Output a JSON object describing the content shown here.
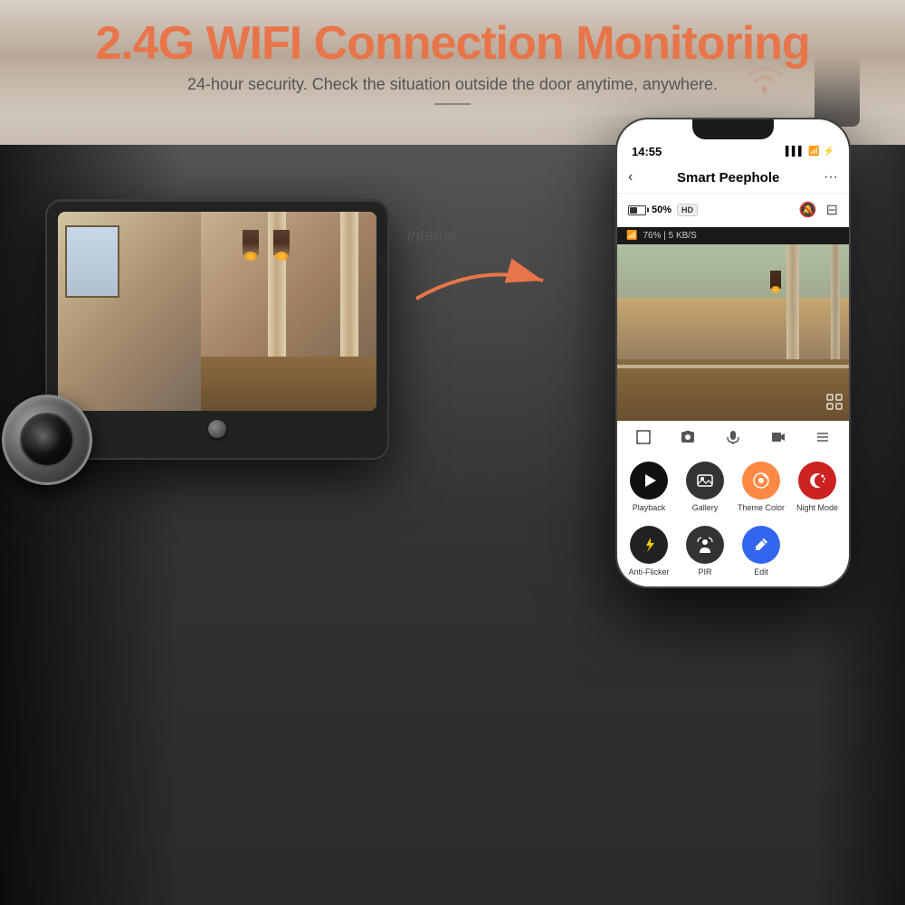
{
  "header": {
    "title": "2.4G WIFI Connection Monitoring",
    "subtitle": "24-hour security. Check the situation outside the door anytime, anywhere."
  },
  "arrow_label": "interne",
  "phone": {
    "status_time": "14:55",
    "signal_text": "76% | 5 KB/S",
    "app_title": "Smart Peephole",
    "battery_percent": "50%",
    "hd_label": "HD",
    "back_icon": "‹",
    "menu_icon": "···",
    "mute_icon": "🔕",
    "layout_icon": "⊟",
    "expand_icon": "⤢",
    "controls": [
      {
        "icon": "⛶",
        "label": "expand"
      },
      {
        "icon": "📷",
        "label": "snapshot"
      },
      {
        "icon": "🎤",
        "label": "mic"
      },
      {
        "icon": "▷",
        "label": "record"
      },
      {
        "icon": "≡",
        "label": "menu"
      }
    ],
    "app_items_row1": [
      {
        "label": "Playback",
        "icon": "▶",
        "color": "#222"
      },
      {
        "label": "Gallery",
        "icon": "🖼",
        "color": "#555"
      },
      {
        "label": "Theme\nColor",
        "icon": "🎨",
        "color": "#e8754a"
      },
      {
        "label": "Night\nMode",
        "icon": "🌙",
        "color": "#e84040"
      }
    ],
    "app_items_row2": [
      {
        "label": "Anti-Flick\ner",
        "icon": "⚡",
        "color": "#ffcc00"
      },
      {
        "label": "PIR",
        "icon": "👾",
        "color": "#555"
      },
      {
        "label": "Edit",
        "icon": "✏",
        "color": "#4488ff"
      },
      {
        "label": "",
        "icon": "",
        "color": "transparent"
      }
    ]
  }
}
